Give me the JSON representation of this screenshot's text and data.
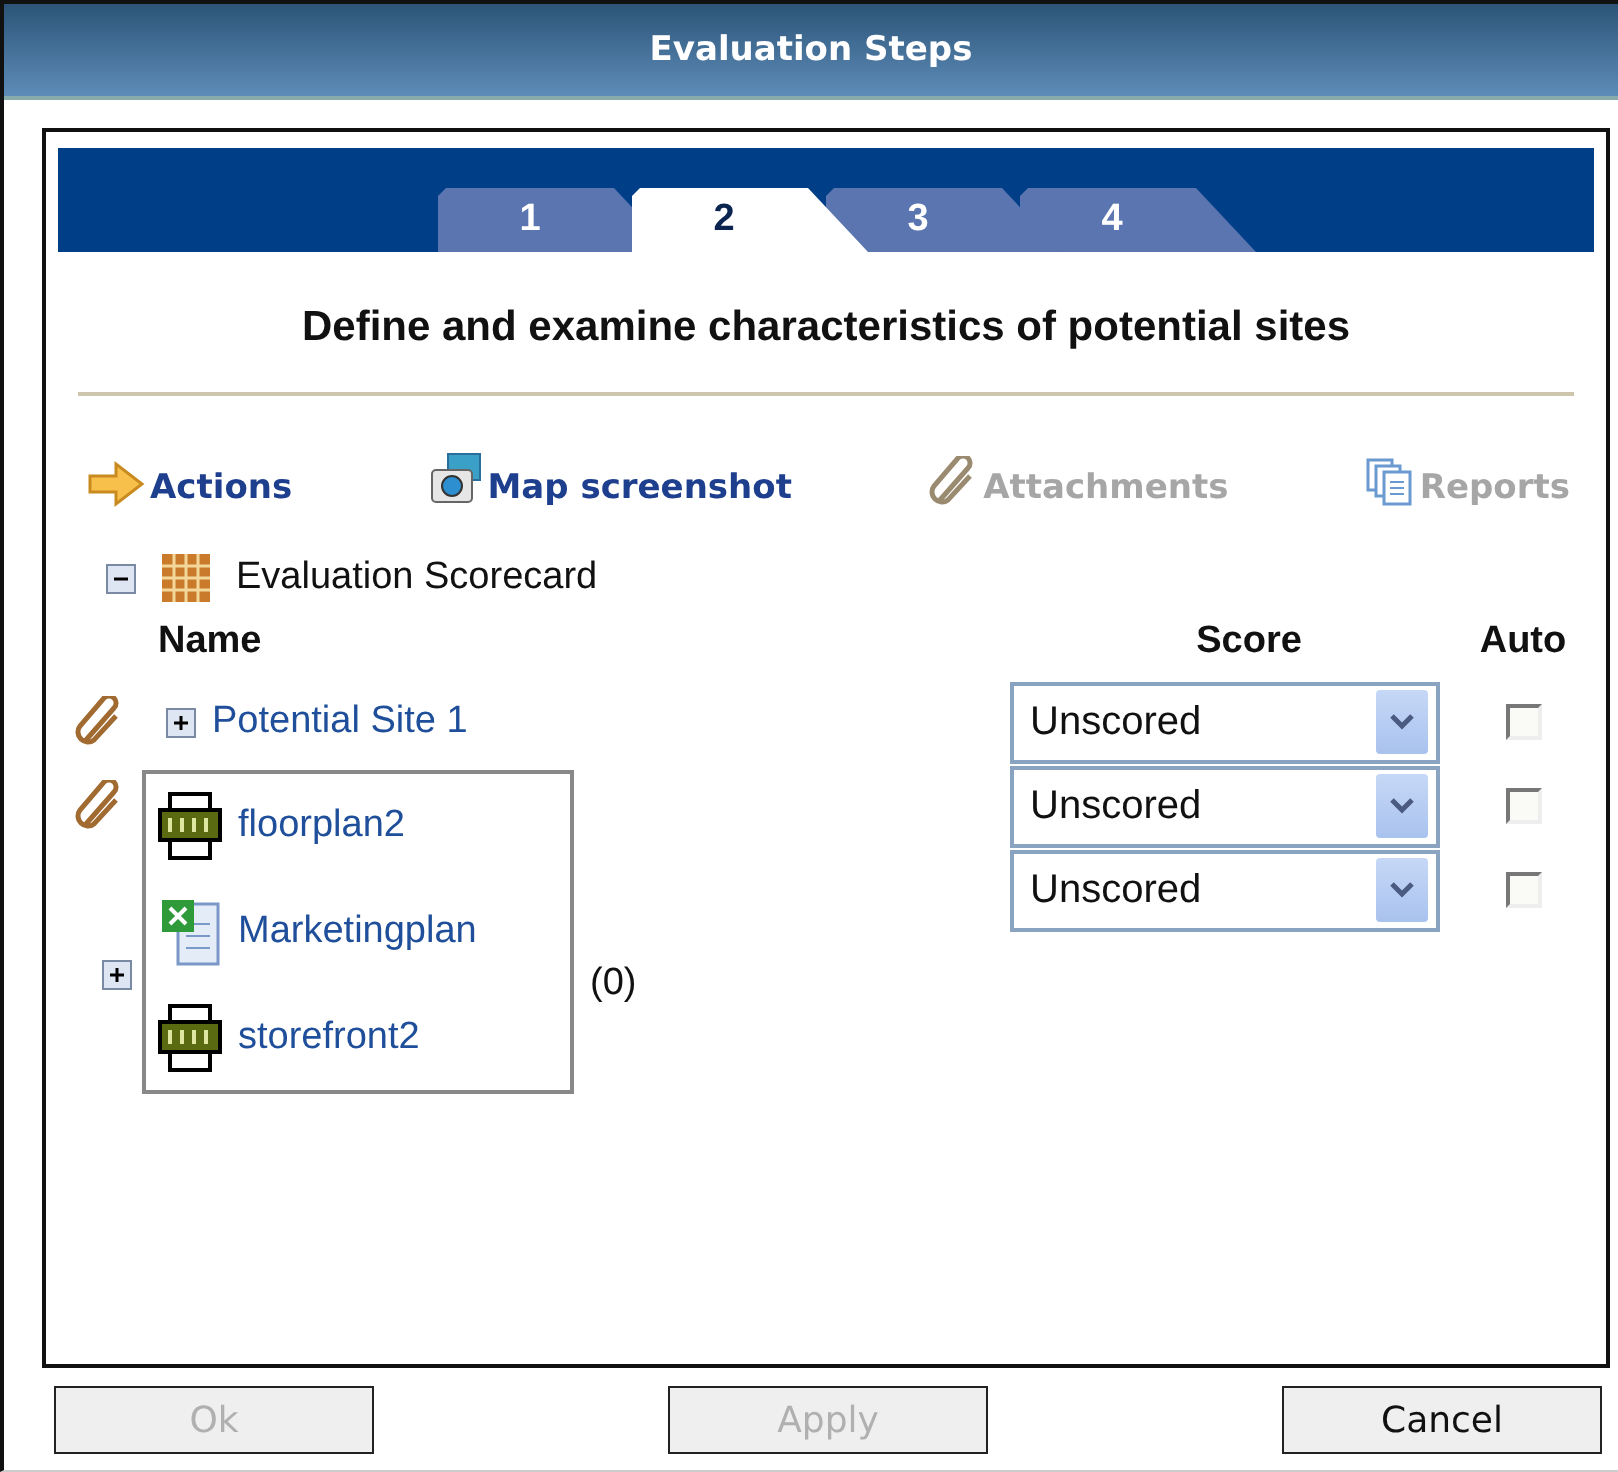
{
  "window": {
    "title": "Evaluation Steps"
  },
  "tabs": [
    {
      "label": "1",
      "selected": false
    },
    {
      "label": "2",
      "selected": true
    },
    {
      "label": "3",
      "selected": false
    },
    {
      "label": "4",
      "selected": false
    }
  ],
  "heading": "Define and examine characteristics of potential sites",
  "toolbar": [
    {
      "kind": "actions",
      "label": "Actions",
      "disabled": false
    },
    {
      "kind": "camera",
      "label": "Map screenshot",
      "disabled": false
    },
    {
      "kind": "clip",
      "label": "Attachments",
      "disabled": true
    },
    {
      "kind": "pages",
      "label": "Reports",
      "disabled": true
    }
  ],
  "tree": {
    "label": "Evaluation Scorecard",
    "expanded": true
  },
  "columns": {
    "name": "Name",
    "score": "Score",
    "auto": "Auto"
  },
  "rows": [
    {
      "attachment": true,
      "expander": true,
      "name": "Potential Site 1",
      "score": "Unscored",
      "auto": false
    },
    {
      "attachment": true,
      "score": "Unscored",
      "auto": false
    },
    {
      "attachment": false,
      "score": "Unscored",
      "auto": false
    },
    {
      "attachment": false,
      "expander": true,
      "count": "(0)"
    }
  ],
  "popup": [
    {
      "kind": "jpg",
      "name": "floorplan2"
    },
    {
      "kind": "xls",
      "name": "Marketingplan"
    },
    {
      "kind": "jpg",
      "name": "storefront2"
    }
  ],
  "buttons": [
    {
      "label": "Ok",
      "disabled": true
    },
    {
      "label": "Apply",
      "disabled": true
    },
    {
      "label": "Cancel",
      "disabled": false
    }
  ]
}
